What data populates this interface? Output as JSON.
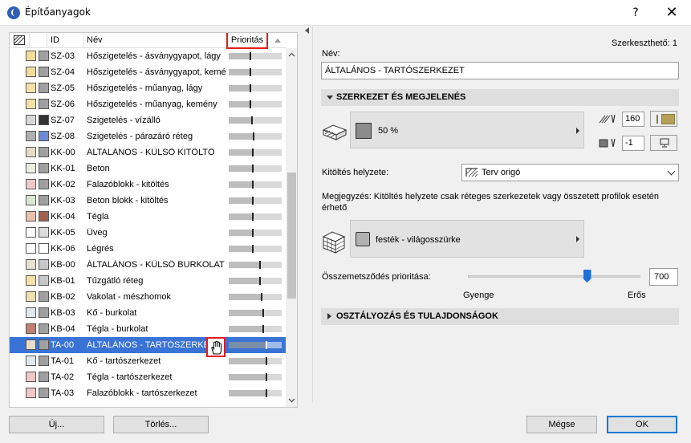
{
  "window": {
    "title": "Építőanyagok",
    "help_label": "?",
    "close_label": "✕"
  },
  "list": {
    "headers": {
      "id": "ID",
      "nev": "Név",
      "prioritas": "Prioritás"
    },
    "rows": [
      {
        "id": "SZ-03",
        "nev": "Hőszigetelés - ásványgyapot, lágy",
        "sw1": "#f2dc9c",
        "sw2": "#a0a0a0",
        "priority": 0.4
      },
      {
        "id": "SZ-04",
        "nev": "Hőszigetelés - ásványgyapot, kemény",
        "sw1": "#f2dc9c",
        "sw2": "#a0a0a0",
        "priority": 0.4
      },
      {
        "id": "SZ-05",
        "nev": "Hőszigetelés - műanyag, lágy",
        "sw1": "#f5e1a8",
        "sw2": "#a0a0a0",
        "priority": 0.4
      },
      {
        "id": "SZ-06",
        "nev": "Hőszigetelés - műanyag, kemény",
        "sw1": "#f5e1a8",
        "sw2": "#a0a0a0",
        "priority": 0.4
      },
      {
        "id": "SZ-07",
        "nev": "Szigetelés - vízálló",
        "sw1": "#d8d8d8",
        "sw2": "#333333",
        "priority": 0.42
      },
      {
        "id": "SZ-08",
        "nev": "Szigetelés - párazáró réteg",
        "sw1": "#b0b0b0",
        "sw2": "#6a8ad8",
        "priority": 0.46
      },
      {
        "id": "KK-00",
        "nev": "ÁLTALÁNOS - KÜLSŐ KITÖLTŐ",
        "sw1": "#e6dcc8",
        "sw2": "#a0a0a0",
        "priority": 0.44
      },
      {
        "id": "KK-01",
        "nev": "Beton",
        "sw1": "#e8f0e0",
        "sw2": "#a0a0a0",
        "priority": 0.44
      },
      {
        "id": "KK-02",
        "nev": "Falazóblokk - kitöltés",
        "sw1": "#f0c8c8",
        "sw2": "#a0a0a0",
        "priority": 0.44
      },
      {
        "id": "KK-03",
        "nev": "Beton blokk - kitöltés",
        "sw1": "#d8e8d0",
        "sw2": "#a0a0a0",
        "priority": 0.44
      },
      {
        "id": "KK-04",
        "nev": "Tégla",
        "sw1": "#e8c0b0",
        "sw2": "#a06050",
        "priority": 0.44
      },
      {
        "id": "KK-05",
        "nev": "Üveg",
        "sw1": "#ffffff",
        "sw2": "#dddddd",
        "priority": 0.44
      },
      {
        "id": "KK-06",
        "nev": "Légrés",
        "sw1": "#ffffff",
        "sw2": "#ffffff",
        "priority": 0.44
      },
      {
        "id": "KB-00",
        "nev": "ÁLTALÁNOS - KÜLSŐ BURKOLAT",
        "sw1": "#e8e0d0",
        "sw2": "#c8c8c8",
        "priority": 0.58
      },
      {
        "id": "KB-01",
        "nev": "Tűzgátló réteg",
        "sw1": "#f5e1a8",
        "sw2": "#c8c8c8",
        "priority": 0.58
      },
      {
        "id": "KB-02",
        "nev": "Vakolat - mészhomok",
        "sw1": "#f0e0b0",
        "sw2": "#a0a0a0",
        "priority": 0.6
      },
      {
        "id": "KB-03",
        "nev": "Kő - burkolat",
        "sw1": "#e0e8f0",
        "sw2": "#a0a0a0",
        "priority": 0.64
      },
      {
        "id": "KB-04",
        "nev": "Tégla - burkolat",
        "sw1": "#c08070",
        "sw2": "#a0a0a0",
        "priority": 0.64
      },
      {
        "id": "TA-00",
        "nev": "ÁLTALÁNOS - TARTÓSZERKEZET",
        "sw1": "#e6dcc8",
        "sw2": "#a0a0a0",
        "priority": 0.7,
        "selected": true
      },
      {
        "id": "TA-01",
        "nev": "Kő - tartószerkezet",
        "sw1": "#e0e8f0",
        "sw2": "#a0a0a0",
        "priority": 0.7
      },
      {
        "id": "TA-02",
        "nev": "Tégla - tartószerkezet",
        "sw1": "#f0c8c8",
        "sw2": "#a0a0a0",
        "priority": 0.7
      },
      {
        "id": "TA-03",
        "nev": "Falazóblokk - tartószerkezet",
        "sw1": "#f0c8c8",
        "sw2": "#a0a0a0",
        "priority": 0.7
      }
    ]
  },
  "left_buttons": {
    "new": "Új...",
    "delete": "Törlés..."
  },
  "detail": {
    "editable_label": "Szerkeszthető: 1",
    "name_label": "Név:",
    "name_value": "ÁLTALÁNOS - TARTÓSZERKEZET",
    "section_structure": "SZERKEZET ÉS MEGJELENÉS",
    "fill_label": "50 %",
    "pen_fg": "160",
    "pen_bg": "-1",
    "fill_position_label": "Kitöltés helyzete:",
    "fill_position_value": "Terv origó",
    "note": "Megjegyzés: Kitöltés helyzete csak réteges szerkezetek vagy összetett profilok esetén érhető",
    "surface_label": "festék - világosszürke",
    "overlap_label": "Összemetsződés prioritása:",
    "overlap_value": "700",
    "overlap_fraction": 0.7,
    "weak_label": "Gyenge",
    "strong_label": "Erős",
    "section_classification": "OSZTÁLYOZÁS ÉS TULAJDONSÁGOK"
  },
  "bottom_buttons": {
    "cancel": "Mégse",
    "ok": "OK"
  },
  "colors": {
    "selection": "#3a73d6",
    "highlight_box": "#e31b1b",
    "slider": "#1e6fd9",
    "pen_color": "#b5a05a"
  }
}
